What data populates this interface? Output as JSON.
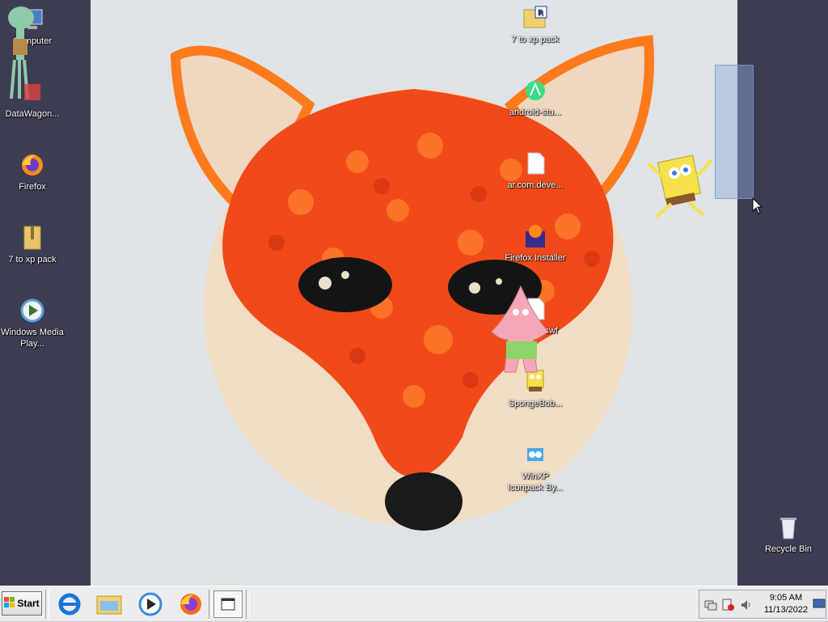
{
  "desktop": {
    "left_icons": [
      {
        "label": "Computer"
      },
      {
        "label": "DataWagon..."
      },
      {
        "label": "Firefox"
      },
      {
        "label": "7 to xp pack"
      },
      {
        "label": "Windows Media Play..."
      }
    ],
    "right_icons": [
      {
        "label": "7 to xp pack"
      },
      {
        "label": "android-stu..."
      },
      {
        "label": "ar.com.deve..."
      },
      {
        "label": "Firefox Installer"
      },
      {
        "label": "...swf"
      },
      {
        "label": "SpongeBob..."
      },
      {
        "label": "WinXP Iconpack By..."
      }
    ],
    "recycle_bin": {
      "label": "Recycle Bin"
    },
    "wallpaper": {
      "subject": "fox-cake"
    }
  },
  "taskbar": {
    "start_label": "Start",
    "quick_launch": [
      "internet-explorer-icon",
      "folder-icon",
      "media-player-icon",
      "firefox-icon"
    ],
    "active_task_icon": "window-icon",
    "tray_icons": [
      "network-icon",
      "error-shield-icon",
      "volume-icon"
    ],
    "clock": {
      "time": "9:05 AM",
      "date": "11/13/2022"
    }
  },
  "colors": {
    "taskbar": "#ecedef",
    "desktop_bg": "#3c3c52",
    "accent_orange": "#f0521e"
  }
}
